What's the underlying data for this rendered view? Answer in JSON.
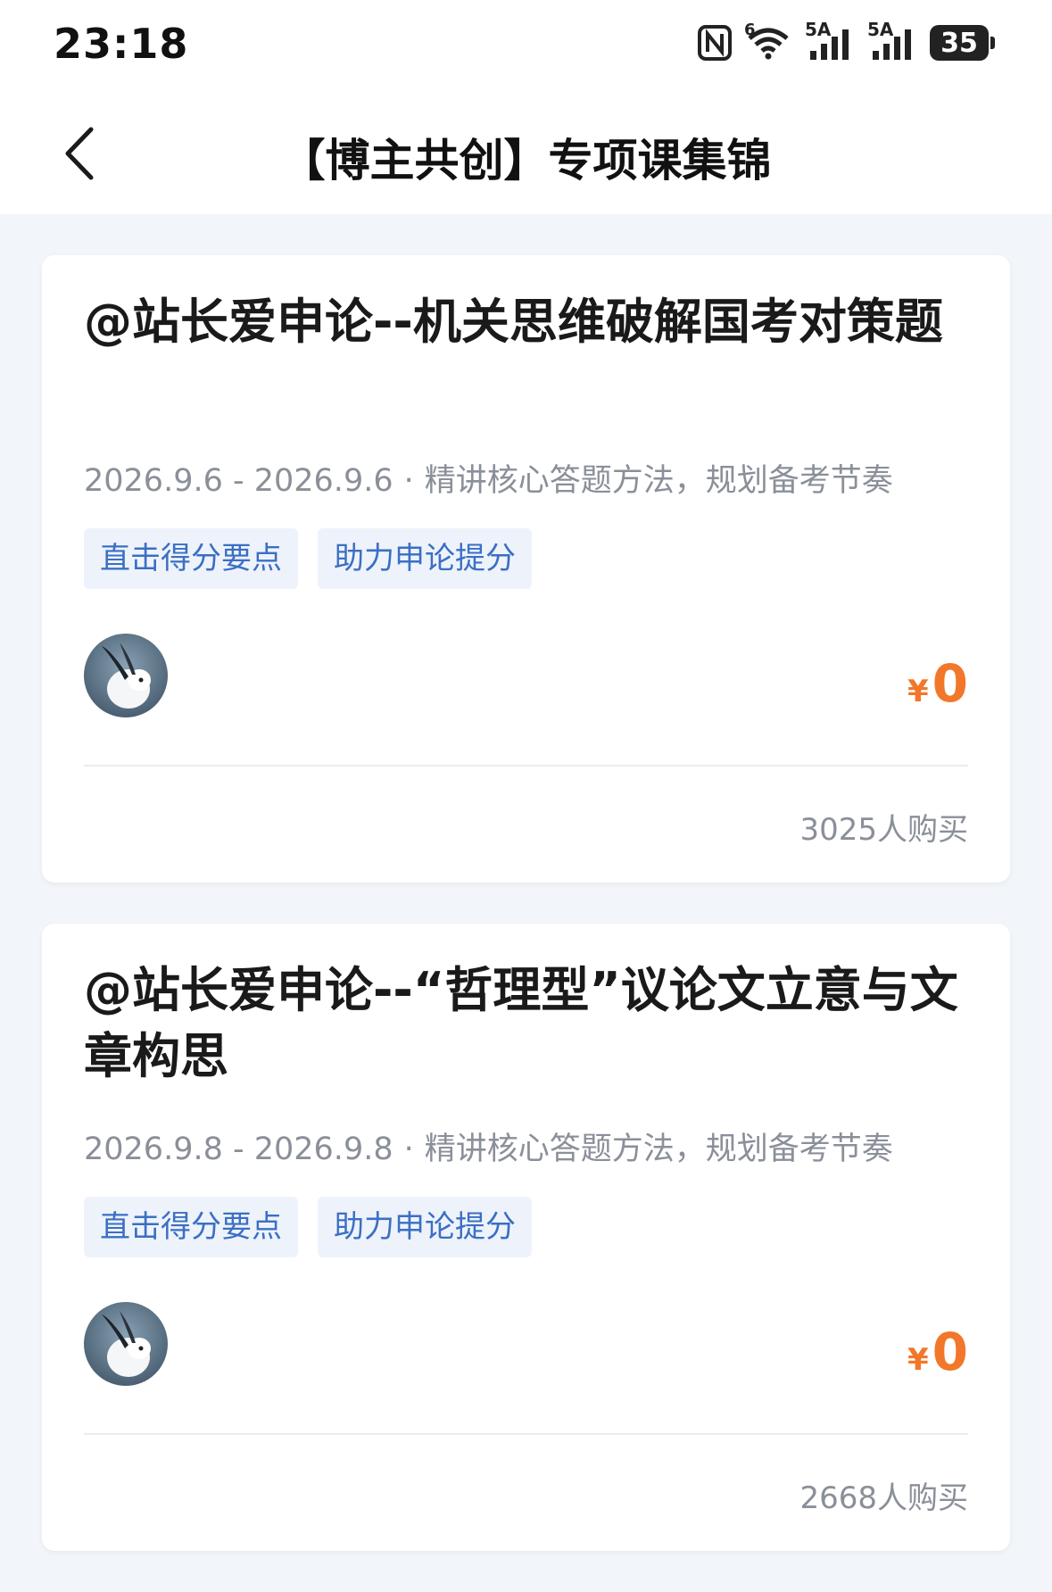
{
  "status_bar": {
    "time": "23:18",
    "network_1": "5A",
    "network_2": "5A",
    "wifi_badge": "6",
    "battery": "35"
  },
  "nav": {
    "title": "【博主共创】专项课集锦"
  },
  "courses": [
    {
      "title": "@站长爱申论--机关思维破解国考对策题",
      "date_range": "2026.9.6 - 2026.9.6",
      "dot": "·",
      "description": "精讲核心答题方法，规划备考节奏",
      "tags": [
        "直击得分要点",
        "助力申论提分"
      ],
      "currency": "¥",
      "price": "0",
      "buyers": "3025人购买"
    },
    {
      "title": "@站长爱申论--“哲理型”议论文立意与文章构思",
      "date_range": "2026.9.8 - 2026.9.8",
      "dot": "·",
      "description": "精讲核心答题方法，规划备考节奏",
      "tags": [
        "直击得分要点",
        "助力申论提分"
      ],
      "currency": "¥",
      "price": "0",
      "buyers": "2668人购买"
    }
  ],
  "colors": {
    "price": "#f2772a",
    "tag_text": "#3b6fc4",
    "tag_bg": "#eef3fb",
    "page_bg": "#f2f5f9"
  },
  "icons": {
    "back": "chevron-left-icon",
    "nfc": "nfc-icon",
    "wifi": "wifi-icon",
    "signal": "signal-icon",
    "battery": "battery-icon"
  }
}
